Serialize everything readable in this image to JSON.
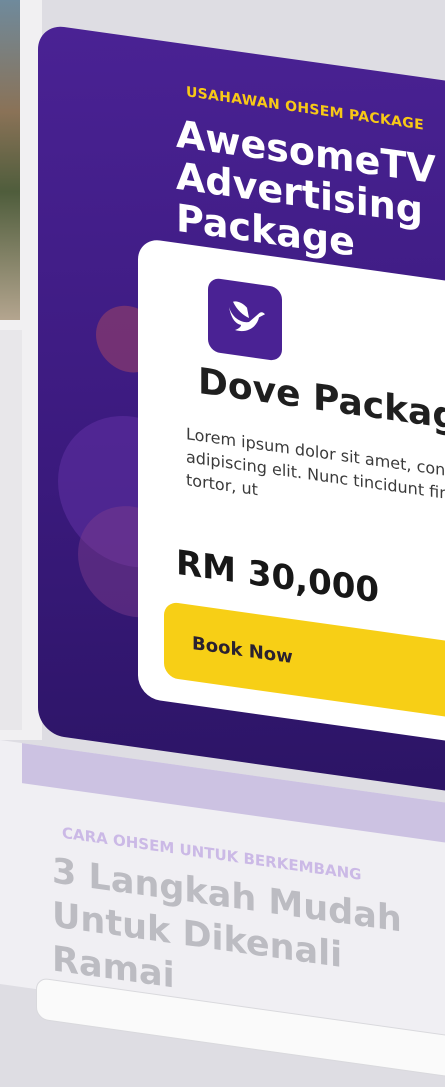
{
  "hero": {
    "eyebrow": "USAHAWAN OHSEM PACKAGE",
    "title": "AwesomeTV Advertising Package",
    "background_color": "#3b1a7e"
  },
  "card": {
    "icon": "dove-icon",
    "title": "Dove Package",
    "description": "Lorem ipsum dolor sit amet, consectetur adipiscing elit. Nunc tincidunt finibus tortor, ut",
    "price": "RM 30,000",
    "button_label": "Book Now",
    "button_color": "#f7cf16"
  },
  "carousel": {
    "total": 4,
    "active": 1
  },
  "section": {
    "eyebrow": "CARA OHSEM UNTUK BERKEMBANG",
    "title": "3 Langkah Mudah Untuk Dikenali Ramai"
  }
}
